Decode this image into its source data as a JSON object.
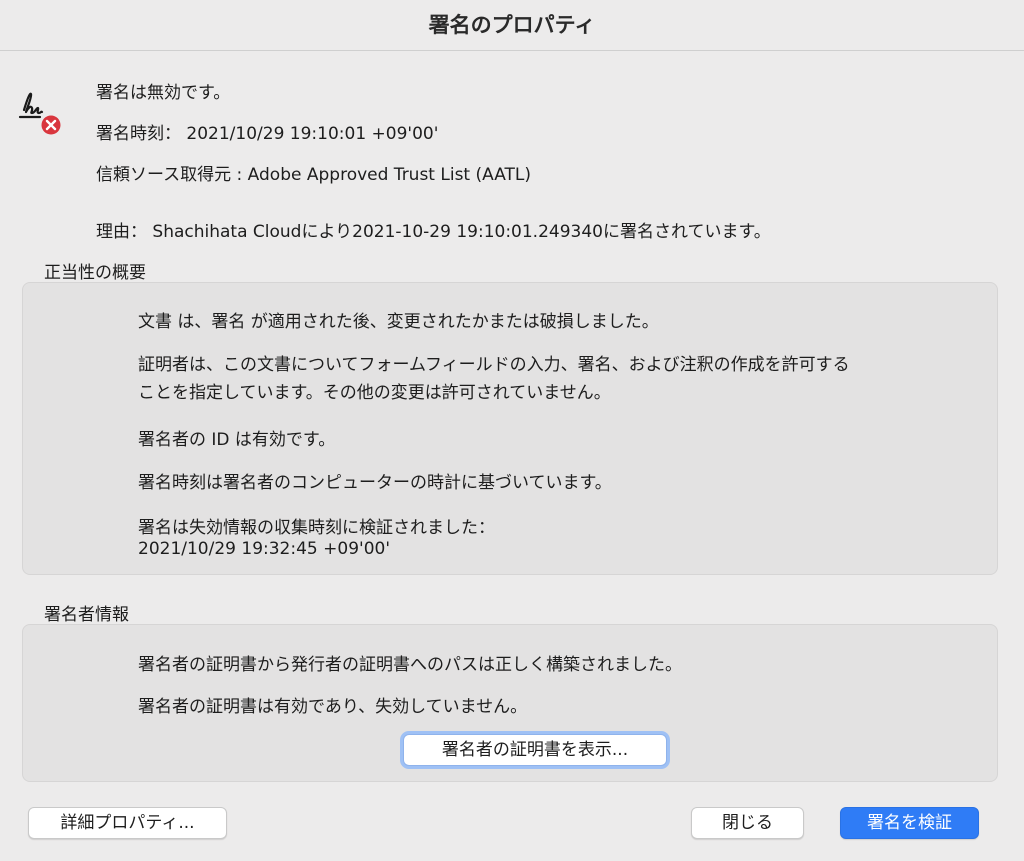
{
  "window": {
    "title": "署名のプロパティ"
  },
  "signature": {
    "status": "署名は無効です。",
    "signing_time": "署名時刻： 2021/10/29 19:10:01 +09'00'",
    "trust_source": "信頼ソース取得元 : Adobe Approved Trust List (AATL)",
    "reason": "理由： Shachihata Cloudにより2021-10-29 19:10:01.249340に署名されています。"
  },
  "validity_summary": {
    "label": "正当性の概要",
    "lines": [
      "文書 は、署名 が適用された後、変更されたかまたは破損しました。",
      "証明者は、この文書についてフォームフィールドの入力、署名、および注釈の作成を許可する",
      "ことを指定しています。その他の変更は許可されていません。",
      "署名者の ID は有効です。",
      "署名時刻は署名者のコンピューターの時計に基づいています。",
      "署名は失効情報の収集時刻に検証されました：",
      "2021/10/29 19:32:45 +09'00'"
    ]
  },
  "signer_info": {
    "label": "署名者情報",
    "lines": [
      "署名者の証明書から発行者の証明書へのパスは正しく構築されました。",
      "署名者の証明書は有効であり、失効していません。"
    ],
    "show_certificate_button": "署名者の証明書を表示..."
  },
  "footer": {
    "advanced_properties_button": "詳細プロパティ...",
    "close_button": "閉じる",
    "validate_button": "署名を検証"
  },
  "colors": {
    "accent": "#2F7CF6",
    "error": "#D9363E",
    "background": "#ECEBEB",
    "panel": "#E3E2E2"
  },
  "icons": {
    "signature_status": "signature-invalid-icon"
  }
}
